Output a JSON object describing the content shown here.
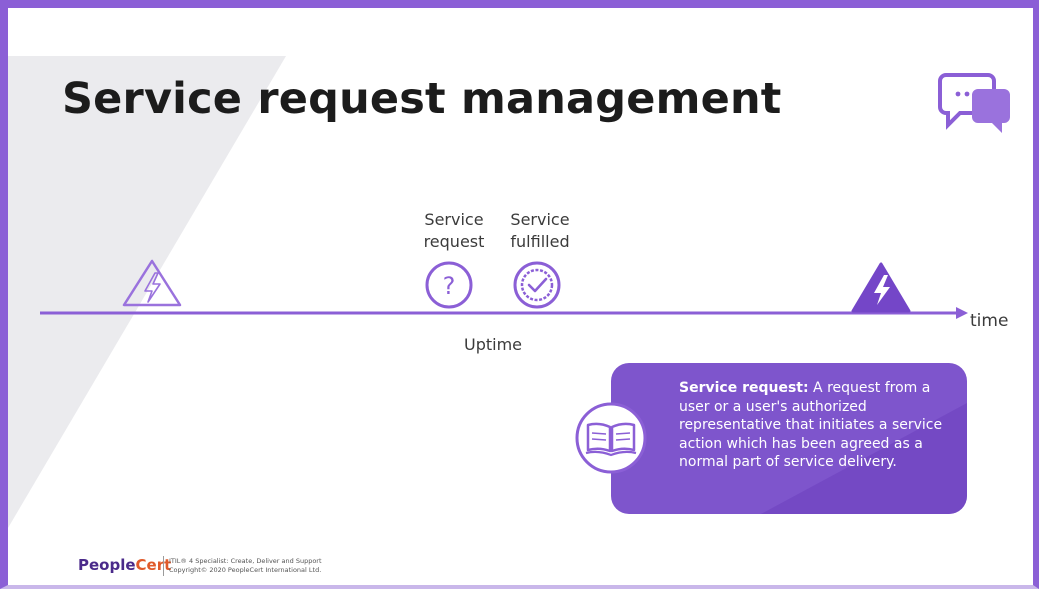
{
  "slide": {
    "title": "Service request management",
    "events": {
      "service_request": {
        "line1": "Service",
        "line2": "request",
        "icon": "question-mark-icon"
      },
      "service_fulfilled": {
        "line1": "Service",
        "line2": "fulfilled",
        "icon": "check-badge-icon"
      },
      "left_incident": {
        "icon": "lightning-warning-outline-icon"
      },
      "right_incident": {
        "icon": "lightning-warning-filled-icon"
      }
    },
    "timeline": {
      "axis_label": "time",
      "span_label": "Uptime"
    },
    "definition": {
      "term": "Service request:",
      "text": " A request from a user or a user's authorized representative that initiates a service action which has been agreed as a normal part of service delivery.",
      "icon": "open-book-icon"
    },
    "header_icon": "chat-bubbles-icon"
  },
  "footer": {
    "logo_part1": "People",
    "logo_part2": "Cert",
    "line1": "ITIL® 4 Specialist: Create, Deliver and Support",
    "line2": "Copyright© 2020 PeopleCert International Ltd."
  },
  "colors": {
    "accent": "#8b5fd6",
    "box": "#7e55cc",
    "text": "#1c1c1c"
  }
}
